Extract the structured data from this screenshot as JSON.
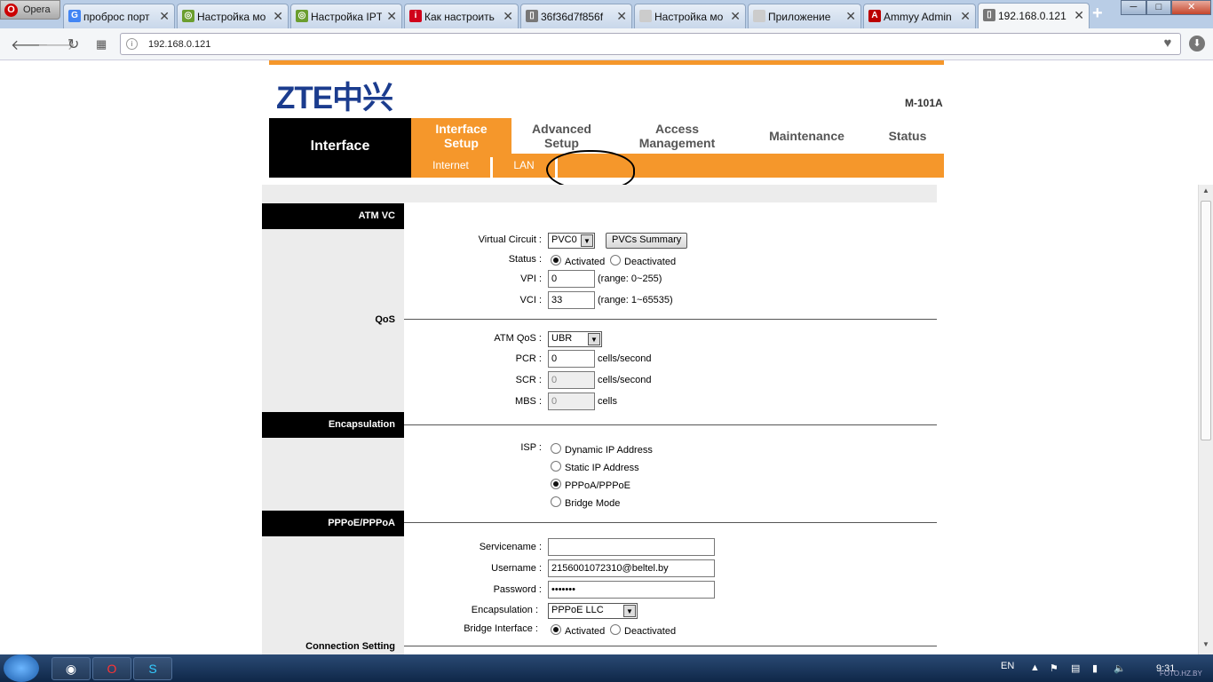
{
  "browser": {
    "opera_label": "Opera",
    "tabs": [
      {
        "title": "проброс порт",
        "fav": "G",
        "color": "#4285f4"
      },
      {
        "title": "Настройка мо",
        "fav": "◎",
        "color": "#6b9e2f"
      },
      {
        "title": "Настройка IPT",
        "fav": "◎",
        "color": "#6b9e2f"
      },
      {
        "title": "Как настроить",
        "fav": "i",
        "color": "#d0021b"
      },
      {
        "title": "36f36d7f856f",
        "fav": "▯",
        "color": "#777"
      },
      {
        "title": "Настройка мо",
        "fav": "",
        "color": "#ccc"
      },
      {
        "title": "Приложение",
        "fav": "",
        "color": "#ccc"
      },
      {
        "title": "Ammyy Admin",
        "fav": "A",
        "color": "#b00"
      },
      {
        "title": "192.168.0.121",
        "fav": "▯",
        "color": "#777"
      }
    ],
    "new_tab": "+",
    "url": "192.168.0.121",
    "win": {
      "min": "─",
      "max": "□",
      "close": "✕"
    }
  },
  "router": {
    "logo": "ZTE中兴",
    "model": "M-101A",
    "section_title": "Interface",
    "nav": [
      {
        "label": "Interface\nSetup",
        "active": true
      },
      {
        "label": "Advanced\nSetup",
        "active": false
      },
      {
        "label": "Access\nManagement",
        "active": false
      },
      {
        "label": "Maintenance",
        "active": false
      },
      {
        "label": "Status",
        "active": false
      }
    ],
    "subnav": [
      "Internet",
      "LAN"
    ]
  },
  "form": {
    "atm_vc": {
      "header": "ATM VC",
      "virtual_circuit_label": "Virtual Circuit :",
      "virtual_circuit_value": "PVC0",
      "pvcs_summary": "PVCs Summary",
      "status_label": "Status :",
      "activated": "Activated",
      "deactivated": "Deactivated",
      "vpi_label": "VPI :",
      "vpi_value": "0",
      "vpi_range": "(range: 0~255)",
      "vci_label": "VCI :",
      "vci_value": "33",
      "vci_range": "(range: 1~65535)"
    },
    "qos": {
      "header": "QoS",
      "atm_qos_label": "ATM QoS :",
      "atm_qos_value": "UBR",
      "pcr_label": "PCR :",
      "pcr_value": "0",
      "scr_label": "SCR :",
      "scr_value": "0",
      "mbs_label": "MBS :",
      "mbs_value": "0",
      "cells_second": "cells/second",
      "cells": "cells"
    },
    "encapsulation": {
      "header": "Encapsulation",
      "isp_label": "ISP :",
      "options": [
        "Dynamic IP Address",
        "Static IP Address",
        "PPPoA/PPPoE",
        "Bridge Mode"
      ],
      "selected": 2
    },
    "pppoe": {
      "header": "PPPoE/PPPoA",
      "servicename_label": "Servicename :",
      "servicename_value": "",
      "username_label": "Username :",
      "username_value": "2156001072310@beltel.by",
      "password_label": "Password :",
      "password_value": "•••••••",
      "encap_label": "Encapsulation :",
      "encap_value": "PPPoE LLC",
      "bridge_label": "Bridge Interface :",
      "activated": "Activated",
      "deactivated": "Deactivated"
    },
    "connection": {
      "header": "Connection Setting"
    }
  },
  "taskbar": {
    "lang": "EN",
    "time": "9:31",
    "watermark": "FOTO.HZ.BY"
  }
}
